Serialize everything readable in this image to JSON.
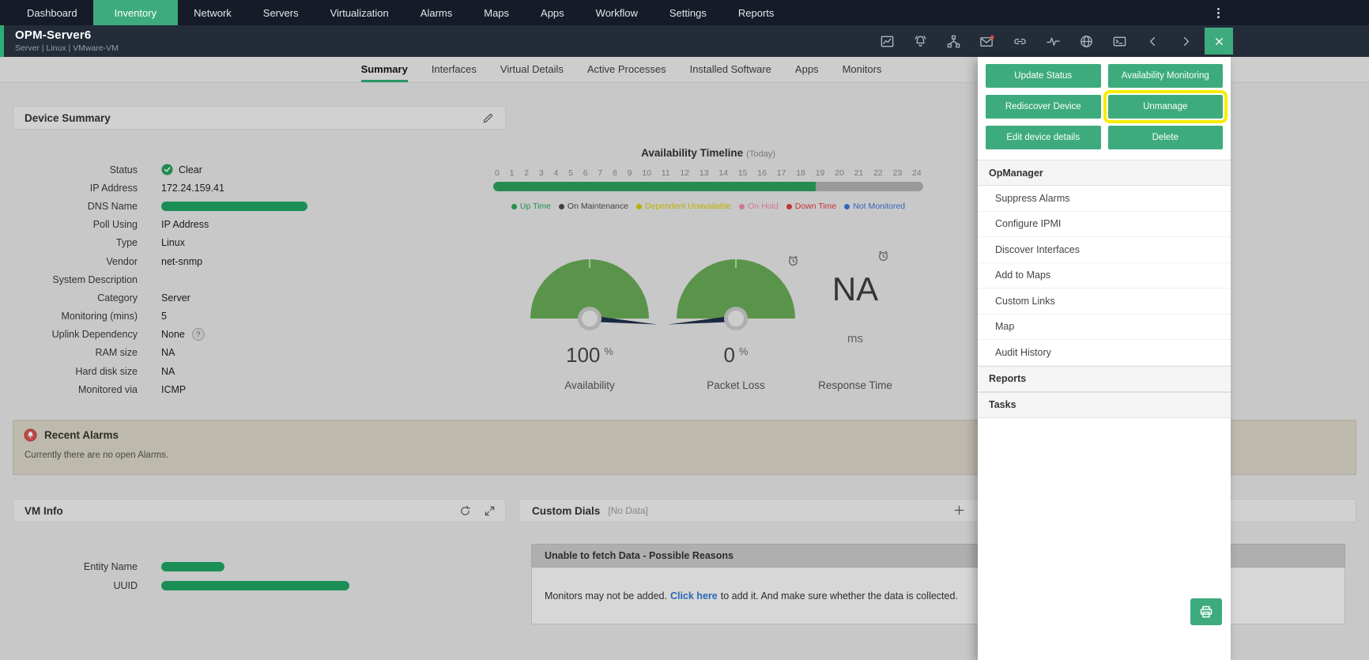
{
  "colors": {
    "accent_green": "#3dab7d",
    "highlight_yellow": "#f6ee00",
    "redacted_pill": "#1fa463",
    "gauge_green": "#68ab57",
    "timeline_green": "#2ca05e"
  },
  "nav": {
    "active": "Inventory",
    "items": [
      {
        "label": "Dashboard"
      },
      {
        "label": "Inventory"
      },
      {
        "label": "Network"
      },
      {
        "label": "Servers"
      },
      {
        "label": "Virtualization"
      },
      {
        "label": "Alarms"
      },
      {
        "label": "Maps"
      },
      {
        "label": "Apps"
      },
      {
        "label": "Workflow"
      },
      {
        "label": "Settings"
      },
      {
        "label": "Reports"
      }
    ]
  },
  "device_header": {
    "title": "OPM-Server6",
    "subtitle": "Server | Linux | VMware-VM",
    "icons": [
      "chart",
      "alarm",
      "topology",
      "mail",
      "link",
      "pulse",
      "globe",
      "console",
      "prev",
      "next"
    ]
  },
  "tabs": {
    "active": "Summary",
    "items": [
      "Summary",
      "Interfaces",
      "Virtual Details",
      "Active Processes",
      "Installed Software",
      "Apps",
      "Monitors"
    ]
  },
  "device_summary": {
    "title": "Device Summary",
    "fields": [
      {
        "label": "Status",
        "value": "Clear",
        "type": "status"
      },
      {
        "label": "IP Address",
        "value": "172.24.159.41",
        "type": "text"
      },
      {
        "label": "DNS Name",
        "value": "",
        "type": "redacted",
        "pill_width": 185
      },
      {
        "label": "Poll Using",
        "value": "IP Address",
        "type": "text"
      },
      {
        "label": "Type",
        "value": "Linux",
        "type": "text"
      },
      {
        "label": "Vendor",
        "value": "net-snmp",
        "type": "text"
      },
      {
        "label": "System Description",
        "value": "",
        "type": "text"
      },
      {
        "label": "Category",
        "value": "Server",
        "type": "text"
      },
      {
        "label": "Monitoring (mins)",
        "value": "5",
        "type": "text"
      },
      {
        "label": "Uplink Dependency",
        "value": "None",
        "type": "help"
      },
      {
        "label": "RAM size",
        "value": "NA",
        "type": "text"
      },
      {
        "label": "Hard disk size",
        "value": "NA",
        "type": "text"
      },
      {
        "label": "Monitored via",
        "value": "ICMP",
        "type": "text"
      }
    ]
  },
  "availability_timeline": {
    "title": "Availability Timeline",
    "subtitle": "(Today)",
    "ticks": [
      "0",
      "1",
      "2",
      "3",
      "4",
      "5",
      "6",
      "7",
      "8",
      "9",
      "10",
      "11",
      "12",
      "13",
      "14",
      "15",
      "16",
      "17",
      "18",
      "19",
      "20",
      "21",
      "22",
      "23",
      "24"
    ],
    "uptime_percent": 75,
    "legend": [
      {
        "label": "Up Time",
        "color": "#2aa55c"
      },
      {
        "label": "On Maintenance",
        "color": "#4a4a4a"
      },
      {
        "label": "Dependent Unavailable",
        "color": "#d8ca00"
      },
      {
        "label": "On Hold",
        "color": "#f08ca4"
      },
      {
        "label": "Down Time",
        "color": "#e23c3c"
      },
      {
        "label": "Not Monitored",
        "color": "#3a77d4"
      }
    ]
  },
  "gauges": [
    {
      "label": "Availability",
      "value": "100",
      "unit": "%",
      "percent": 100
    },
    {
      "label": "Packet Loss",
      "value": "0",
      "unit": "%",
      "percent": 0
    },
    {
      "label": "Response Time",
      "value": "NA",
      "unit": "ms",
      "percent": null
    }
  ],
  "recent_alarms": {
    "title": "Recent Alarms",
    "message": "Currently there are no open Alarms."
  },
  "vm_info": {
    "title": "VM Info",
    "fields": [
      {
        "label": "Entity Name",
        "pill_width": 80
      },
      {
        "label": "UUID",
        "pill_width": 238
      }
    ]
  },
  "custom_dials": {
    "title": "Custom Dials",
    "badge": "[No Data]",
    "error_title": "Unable to fetch Data - Possible Reasons",
    "message_before": "Monitors may not be added.",
    "message_link": "Click here",
    "message_after": "to add it. And make sure whether the data is collected."
  },
  "context_menu": {
    "buttons": [
      {
        "label": "Update Status",
        "highlighted": false
      },
      {
        "label": "Availability Monitoring",
        "highlighted": false
      },
      {
        "label": "Rediscover Device",
        "highlighted": false
      },
      {
        "label": "Unmanage",
        "highlighted": true
      },
      {
        "label": "Edit device details",
        "highlighted": false
      },
      {
        "label": "Delete",
        "highlighted": false
      }
    ],
    "sections": [
      {
        "label": "OpManager",
        "items": [
          "Suppress Alarms",
          "Configure IPMI",
          "Discover Interfaces",
          "Add to Maps",
          "Custom Links",
          "Map",
          "Audit History"
        ]
      },
      {
        "label": "Reports",
        "items": []
      },
      {
        "label": "Tasks",
        "items": []
      }
    ]
  }
}
